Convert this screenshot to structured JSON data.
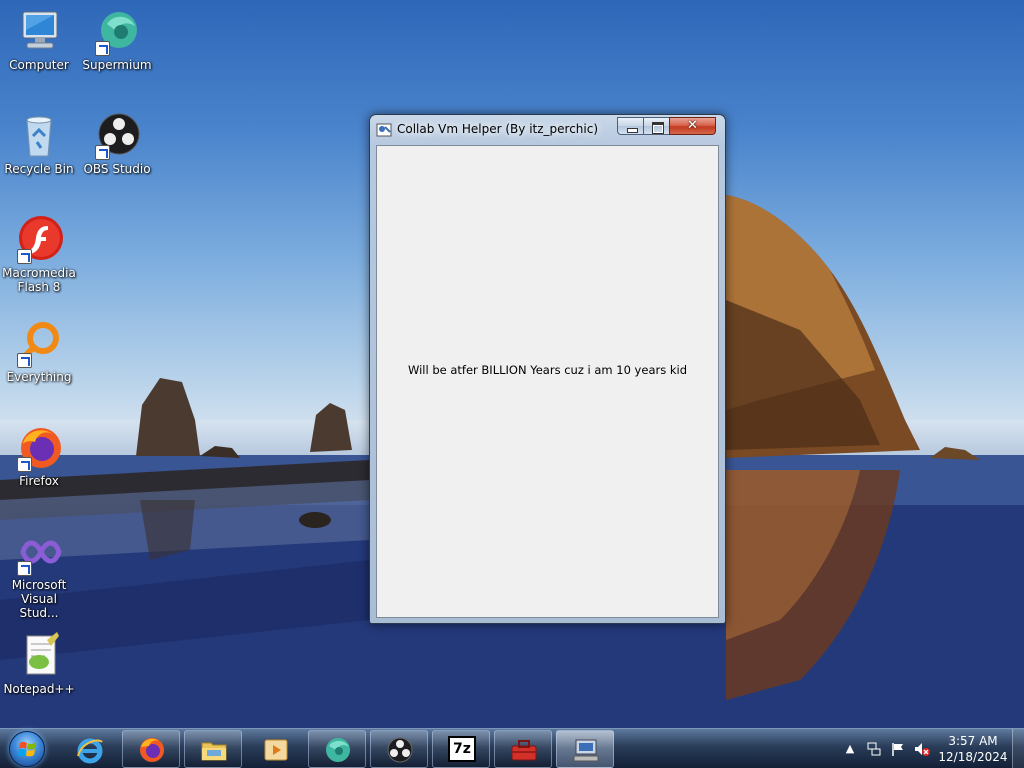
{
  "desktop": {
    "icons": [
      {
        "label": "Computer",
        "icon": "computer-icon"
      },
      {
        "label": "Supermium",
        "icon": "supermium-icon"
      },
      {
        "label": "Recycle Bin",
        "icon": "recycle-bin-icon"
      },
      {
        "label": "OBS Studio",
        "icon": "obs-icon"
      },
      {
        "label": "Macromedia Flash 8",
        "icon": "flash-icon"
      },
      {
        "label": "Everything",
        "icon": "everything-icon"
      },
      {
        "label": "Firefox",
        "icon": "firefox-icon"
      },
      {
        "label": "Microsoft Visual Stud...",
        "icon": "visual-studio-icon"
      },
      {
        "label": "Notepad++",
        "icon": "notepadpp-icon"
      }
    ]
  },
  "window": {
    "title": "Collab Vm Helper (By itz_perchic)",
    "message": "Will be atfer BILLION Years cuz i am 10 years kid",
    "close_glyph": "✕"
  },
  "taskbar": {
    "items": [
      {
        "icon": "internet-explorer-icon",
        "active": false
      },
      {
        "icon": "firefox-icon",
        "active": false
      },
      {
        "icon": "file-explorer-icon",
        "active": false
      },
      {
        "icon": "media-player-icon",
        "active": false
      },
      {
        "icon": "supermium-icon",
        "active": false
      },
      {
        "icon": "obs-icon",
        "active": false
      },
      {
        "icon": "7zip-icon",
        "active": false,
        "text": "7z"
      },
      {
        "icon": "toolbox-icon",
        "active": false
      },
      {
        "icon": "collab-vm-helper-icon",
        "active": true
      }
    ],
    "tray": {
      "time": "3:57 AM",
      "date": "12/18/2024",
      "icons": [
        "show-hidden-icons-icon",
        "network-icon",
        "action-center-flag-icon",
        "volume-muted-icon"
      ]
    }
  },
  "colors": {
    "sky_top": "#2e67b8",
    "sea": "#1d2f6d",
    "close_button": "#c23b1f",
    "window_client": "#f0f0f0"
  }
}
